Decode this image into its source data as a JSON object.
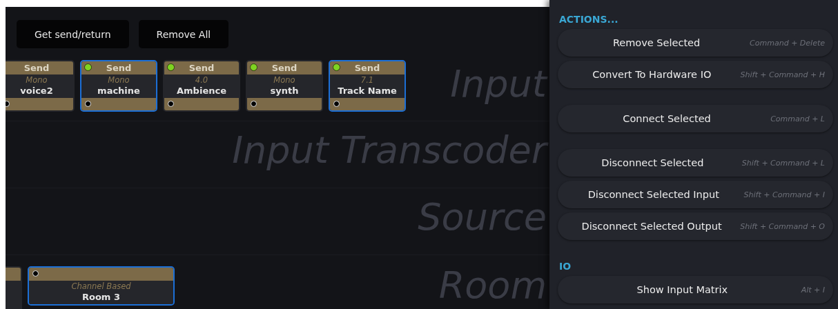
{
  "toolbar": {
    "buttons": [
      "Get send/return",
      "Remove All"
    ]
  },
  "lanes": [
    {
      "label": "Input",
      "nodes": [
        {
          "header": "Send",
          "format": "Mono",
          "name": "voice2",
          "selected": false,
          "cut": true,
          "top_port": false,
          "bottom_port": true
        },
        {
          "header": "Send",
          "format": "Mono",
          "name": "machine",
          "selected": true,
          "top_port": true,
          "port_active": true,
          "bottom_port": true
        },
        {
          "header": "Send",
          "format": "4.0",
          "name": "Ambience",
          "selected": false,
          "top_port": true,
          "port_active": true,
          "bottom_port": true
        },
        {
          "header": "Send",
          "format": "Mono",
          "name": "synth",
          "selected": false,
          "top_port": true,
          "port_active": true,
          "bottom_port": true
        },
        {
          "header": "Send",
          "format": "7.1",
          "name": "Track Name",
          "selected": true,
          "top_port": true,
          "port_active": true,
          "bottom_port": true
        }
      ]
    },
    {
      "label": "Input Transcoder"
    },
    {
      "label": "Source"
    },
    {
      "label": "Room",
      "nodes": [
        {
          "selected": false,
          "cut": true,
          "top_port": false
        },
        {
          "format": "Channel Based",
          "name": "Room 3",
          "selected": true,
          "top_port": true,
          "port_active": false
        }
      ]
    }
  ],
  "panel": {
    "sections": [
      {
        "title": "ACTIONS...",
        "groups": [
          [
            {
              "label": "Remove Selected",
              "shortcut": "Command + Delete"
            },
            {
              "label": "Convert To Hardware IO",
              "shortcut": "Shift + Command + H"
            }
          ],
          [
            {
              "label": "Connect Selected",
              "shortcut": "Command + L"
            }
          ],
          [
            {
              "label": "Disconnect Selected",
              "shortcut": "Shift + Command + L"
            },
            {
              "label": "Disconnect Selected Input",
              "shortcut": "Shift + Command + I"
            },
            {
              "label": "Disconnect Selected Output",
              "shortcut": "Shift + Command + O"
            }
          ]
        ]
      },
      {
        "title": "IO",
        "groups": [
          [
            {
              "label": "Show Input Matrix",
              "shortcut": "Alt + I"
            }
          ]
        ]
      }
    ]
  }
}
